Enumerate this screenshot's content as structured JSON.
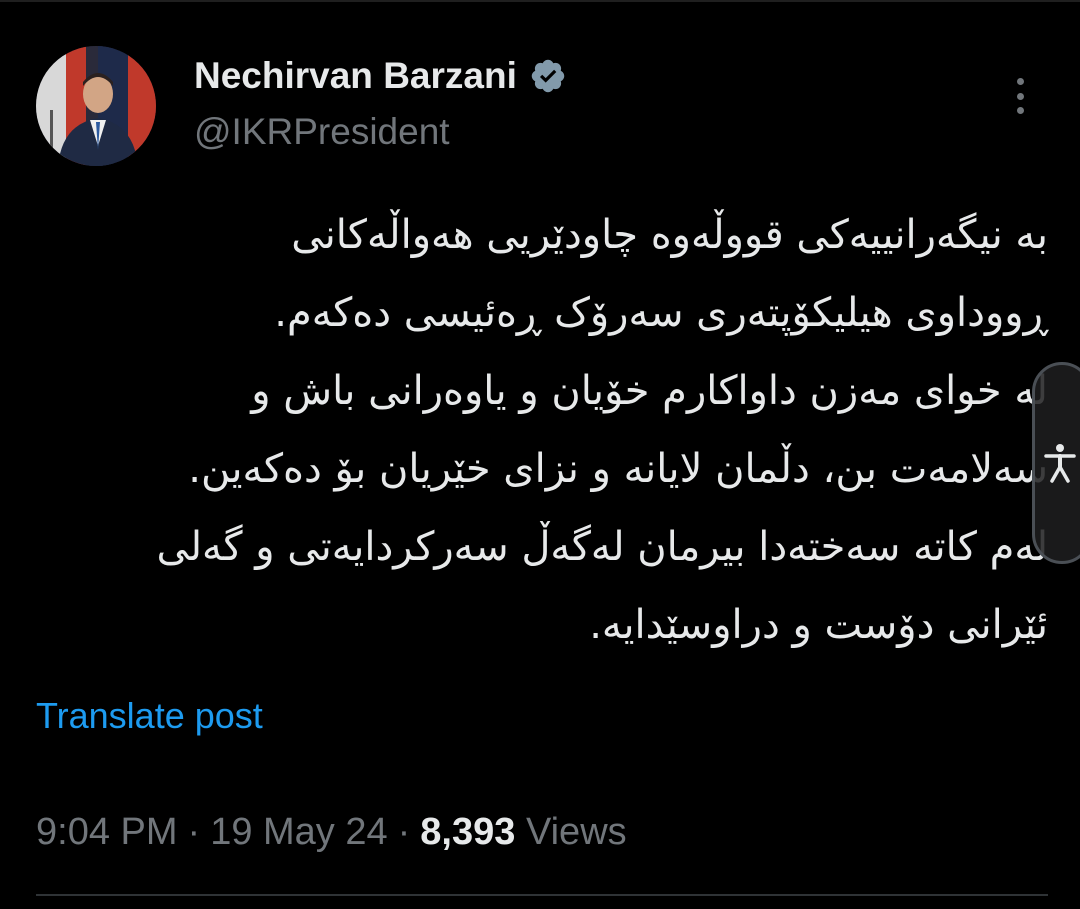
{
  "tweet": {
    "author": {
      "display_name": "Nechirvan Barzani",
      "handle": "@IKRPresident",
      "verified": true
    },
    "text_lines": [
      "به نیگەرانییەکی قووڵەوە چاودێریی هەواڵەکانی",
      "ڕووداوی هیلیکۆپتەری سەرۆک ڕەئیسی دەکەم.",
      "لە خوای مەزن داواکارم خۆیان و یاوەرانی باش و",
      "سەلامەت بن، دڵمان لایانە و نزای خێریان بۆ دەکەین.",
      "لەم کاتە سەختەدا بیرمان لەگەڵ سەرکردایەتی و گەلی",
      "ئێرانی دۆست و دراوسێدایە."
    ],
    "translate_label": "Translate post",
    "time": "9:04 PM",
    "date": "19 May 24",
    "separator": "·",
    "views_count": "8,393",
    "views_label": "Views"
  },
  "icons": {
    "verified": "verified-badge-icon",
    "more": "more-options-icon",
    "accessibility": "accessibility-icon"
  },
  "colors": {
    "background": "#000000",
    "text_primary": "#e7e9ea",
    "text_secondary": "#71767b",
    "link": "#1d9bf0",
    "verified_badge": "#829aab"
  }
}
